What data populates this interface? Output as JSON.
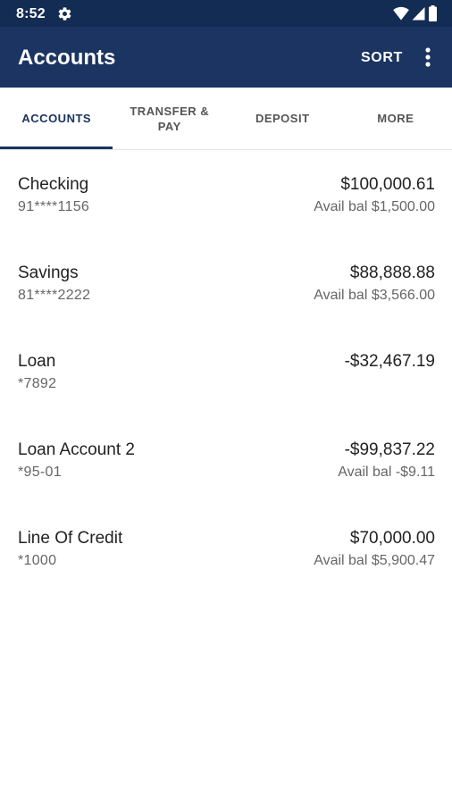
{
  "status_bar": {
    "time": "8:52",
    "left_icon": "gear-icon",
    "right_icons": [
      "wifi-icon",
      "cell-signal-icon",
      "battery-icon"
    ]
  },
  "app_bar": {
    "title": "Accounts",
    "sort_label": "SORT",
    "menu_icon": "overflow-menu-icon",
    "background_color": "#1b3461"
  },
  "tabs": [
    {
      "label": "ACCOUNTS",
      "active": true
    },
    {
      "label": "TRANSFER & PAY",
      "active": false
    },
    {
      "label": "DEPOSIT",
      "active": false
    },
    {
      "label": "MORE",
      "active": false
    }
  ],
  "accounts": [
    {
      "name": "Checking",
      "number": "91****1156",
      "balance": "$100,000.61",
      "available": "Avail bal $1,500.00"
    },
    {
      "name": "Savings",
      "number": "81****2222",
      "balance": "$88,888.88",
      "available": "Avail bal $3,566.00"
    },
    {
      "name": "Loan",
      "number": "*7892",
      "balance": "-$32,467.19",
      "available": ""
    },
    {
      "name": "Loan Account 2",
      "number": "*95-01",
      "balance": "-$99,837.22",
      "available": "Avail bal -$9.11"
    },
    {
      "name": "Line Of Credit",
      "number": "*1000",
      "balance": "$70,000.00",
      "available": "Avail bal $5,900.47"
    }
  ]
}
